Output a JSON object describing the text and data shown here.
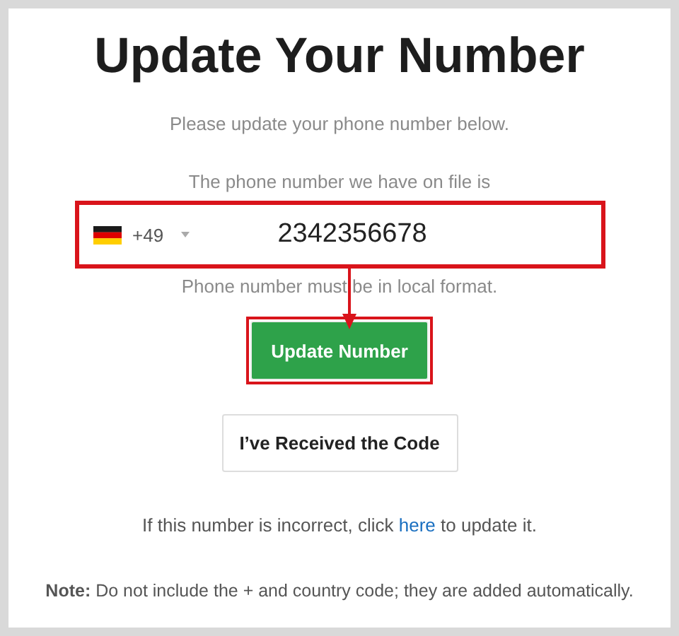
{
  "title": "Update Your Number",
  "subtitle": "Please update your phone number below.",
  "field_label": "The phone number we have on file is",
  "phone_field": {
    "country_code": "+49",
    "value": "2342356678",
    "highlighted": true
  },
  "hint": "Phone number must be in local format.",
  "annotation_arrow": true,
  "buttons": [
    {
      "kind": "primary",
      "label": "Update Number",
      "highlighted": true
    },
    {
      "kind": "secondary",
      "label": "I’ve Received the Code",
      "highlighted": false
    }
  ],
  "incorrect_note": {
    "before": "If this number is incorrect, click",
    "link": "here",
    "after": "to update it."
  },
  "note": "**Note:** Do not include the + and country code; they are added automatically."
}
